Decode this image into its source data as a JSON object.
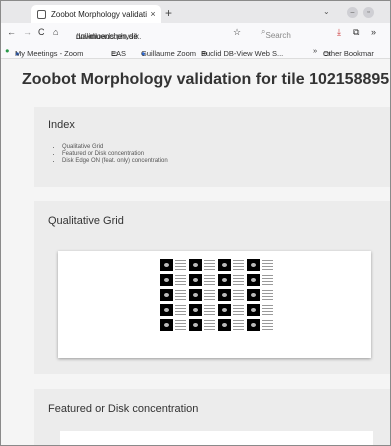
{
  "browser": {
    "tab_title": "Zoobot Morphology validati",
    "tab_close": "×",
    "new_tab": "+",
    "tab_menu": "⌄",
    "nav": {
      "back": "←",
      "forward": "→",
      "reload": "C",
      "home": "⌂"
    },
    "url_prefix": "downloads.physik.",
    "url_domain": "uni-muenchen.de",
    "url_suffix": "/valid",
    "search_placeholder": "Search",
    "bookmarks": [
      "My Meetings - Zoom",
      "EAS",
      "Guillaume Zoom",
      "Euclid DB-View Web S..."
    ],
    "bookmarks_overflow": "»",
    "other_bookmarks": "Other Bookmar"
  },
  "page": {
    "title": "Zoobot Morphology validation for tile 102158895",
    "index": {
      "heading": "Index",
      "items": [
        "Qualitative Grid",
        "Featured or Disk concentration",
        "Disk Edge ON (feat. only) concentration"
      ]
    },
    "qualitative_grid": {
      "heading": "Qualitative Grid"
    },
    "featured": {
      "heading": "Featured or Disk concentration"
    }
  }
}
